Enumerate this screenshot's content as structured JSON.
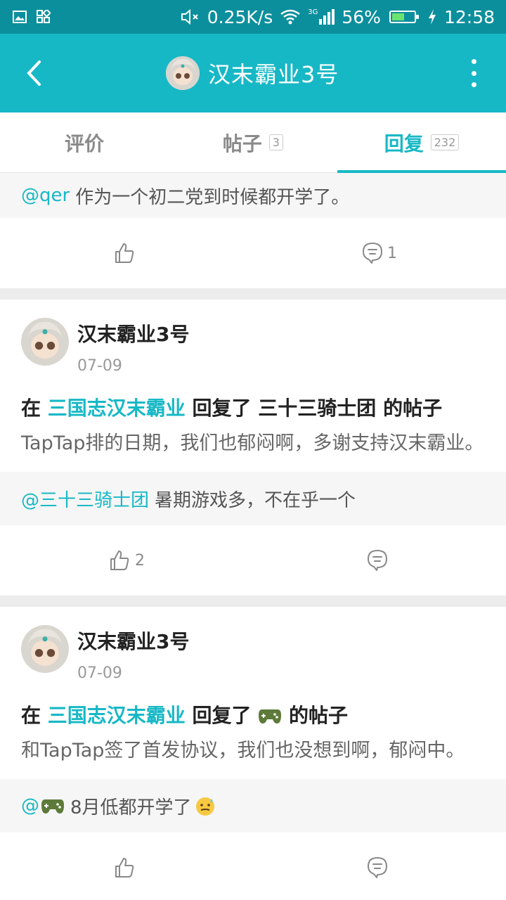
{
  "status_bar": {
    "speed": "0.25K/s",
    "battery": "56%",
    "battery_level": 0.56,
    "time": "12:58",
    "network": "3G"
  },
  "app_bar": {
    "title": "汉末霸业3号"
  },
  "tabs": [
    {
      "label": "评价",
      "count": ""
    },
    {
      "label": "帖子",
      "count": "3"
    },
    {
      "label": "回复",
      "count": "232"
    }
  ],
  "top_reply": {
    "mention": "@qer",
    "text": "作为一个初二党到时候都开学了。",
    "like_count": "",
    "comment_count": "1"
  },
  "posts": [
    {
      "author": "汉末霸业3号",
      "date": "07-09",
      "prefix": "在",
      "game": "三国志汉末霸业",
      "middle": "回复了",
      "target": "三十三骑士团",
      "suffix": "的帖子",
      "body": "TapTap排的日期，我们也郁闷啊，多谢支持汉末霸业。",
      "quote_mention": "@三十三骑士团",
      "quote_text": "暑期游戏多，不在乎一个",
      "like_count": "2",
      "comment_count": ""
    },
    {
      "author": "汉末霸业3号",
      "date": "07-09",
      "prefix": "在",
      "game": "三国志汉末霸业",
      "middle": "回复了",
      "target": "",
      "suffix": "的帖子",
      "body": "和TapTap签了首发协议，我们也没想到啊，郁闷中。",
      "quote_mention": "@",
      "quote_text": "8月低都开学了",
      "like_count": "",
      "comment_count": ""
    }
  ]
}
